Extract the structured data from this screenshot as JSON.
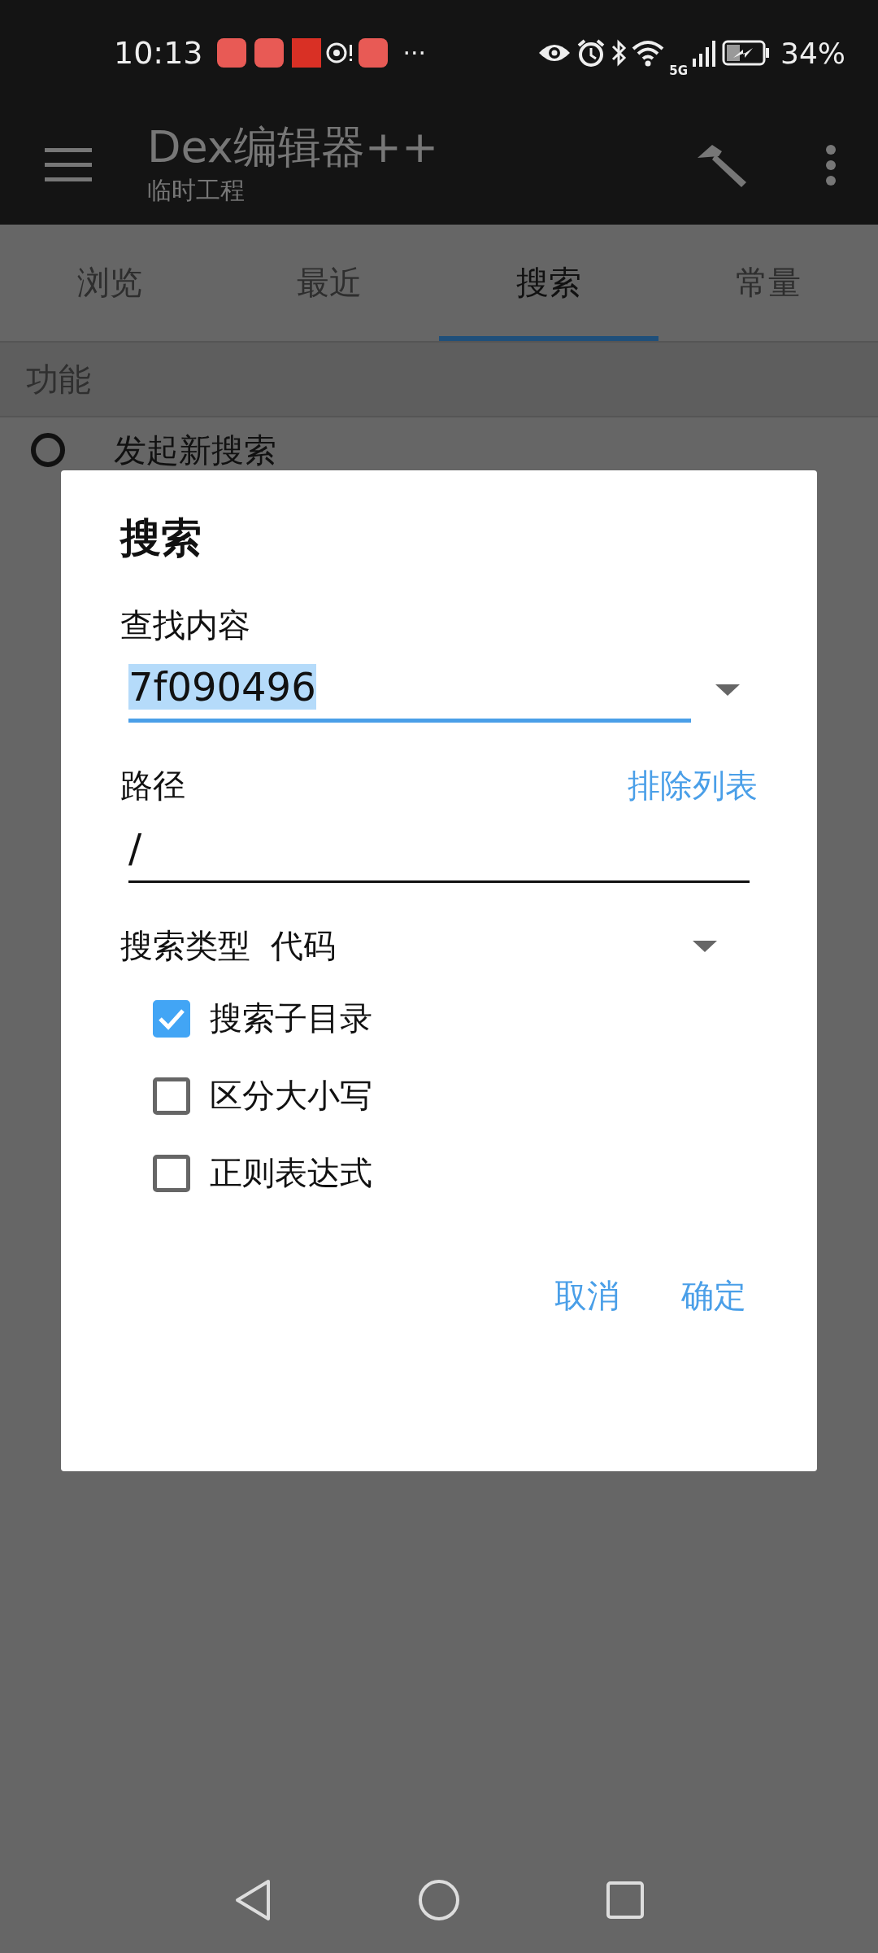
{
  "status_bar": {
    "time": "10:13",
    "overflow": "···",
    "network": "5G",
    "battery": "34%"
  },
  "app_bar": {
    "title": "Dex编辑器++",
    "subtitle": "临时工程"
  },
  "tabs": [
    {
      "label": "浏览",
      "selected": false
    },
    {
      "label": "最近",
      "selected": false
    },
    {
      "label": "搜索",
      "selected": true
    },
    {
      "label": "常量",
      "selected": false
    }
  ],
  "section_header": "功能",
  "list_items": [
    {
      "label": "发起新搜索"
    }
  ],
  "dialog": {
    "title": "搜索",
    "find": {
      "label": "查找内容",
      "value": "7f090496",
      "focused": true,
      "value_selected": true
    },
    "path": {
      "label": "路径",
      "link": "排除列表",
      "value": "/",
      "focused": false
    },
    "search_type": {
      "label": "搜索类型",
      "value": "代码"
    },
    "options": [
      {
        "label": "搜索子目录",
        "checked": true
      },
      {
        "label": "区分大小写",
        "checked": false
      },
      {
        "label": "正则表达式",
        "checked": false
      }
    ],
    "buttons": [
      "取消",
      "确定"
    ]
  }
}
